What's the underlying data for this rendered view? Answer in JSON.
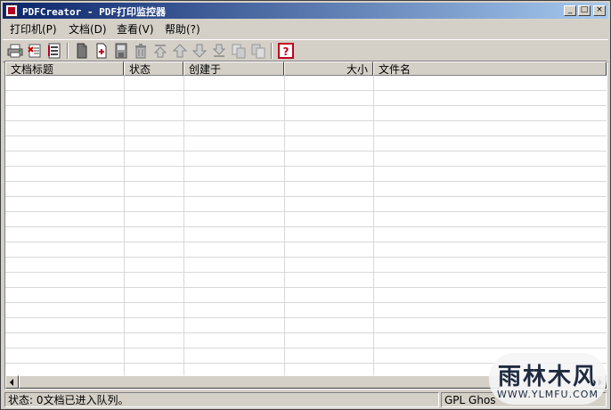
{
  "window": {
    "title": "PDFCreator - PDF打印监控器",
    "buttons": {
      "minimize": "_",
      "maximize": "□",
      "close": "×"
    }
  },
  "menu": {
    "items": [
      {
        "label": "打印机(P)"
      },
      {
        "label": "文档(D)"
      },
      {
        "label": "查看(V)"
      },
      {
        "label": "帮助(?)"
      }
    ]
  },
  "toolbar": {
    "icons": [
      "printer-icon",
      "stop-printing-icon",
      "log-icon",
      "document-icon",
      "add-document-icon",
      "save-document-icon",
      "delete-icon",
      "move-top-icon",
      "move-up-icon",
      "move-down-icon",
      "move-bottom-icon",
      "copy-icon",
      "paste-icon",
      "help-icon"
    ]
  },
  "list": {
    "columns": [
      "文档标题",
      "状态",
      "创建于",
      "大小",
      "文件名"
    ],
    "rows": []
  },
  "status": {
    "text": "状态: 0文档已进入队列。",
    "version": "GPL Ghos"
  },
  "watermark": {
    "main": "雨林木风",
    "url": "WWW.YLMFU.COM"
  },
  "colors": {
    "face": "#d4d0c8",
    "titlebar_start": "#0a246a",
    "titlebar_end": "#a6caf0",
    "help_red": "#c00020"
  }
}
